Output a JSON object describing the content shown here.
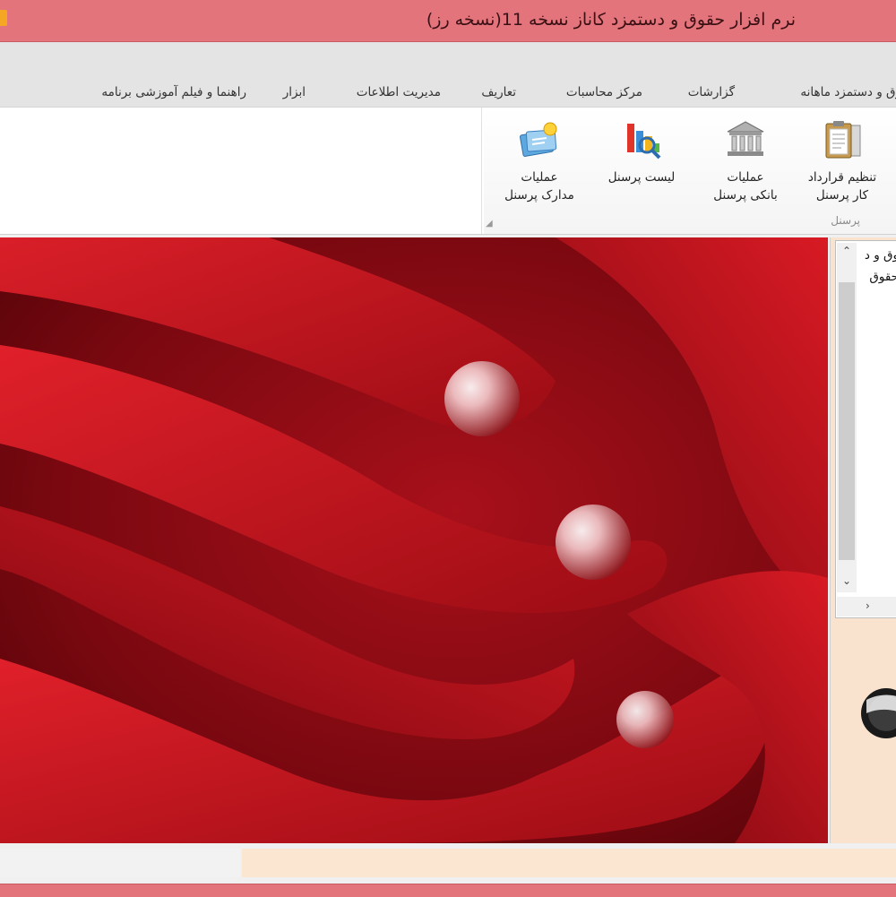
{
  "window": {
    "title": "نرم افزار حقوق و دستمزد کاناز نسخه 11(نسخه رز)"
  },
  "tabs": [
    {
      "label": "وق و دستمزد ماهانه"
    },
    {
      "label": "گزارشات"
    },
    {
      "label": "مرکز محاسبات"
    },
    {
      "label": "تعاریف"
    },
    {
      "label": "مدیریت اطلاعات"
    },
    {
      "label": "ابزار"
    },
    {
      "label": "راهنما و فیلم آموزشی برنامه"
    }
  ],
  "ribbon": {
    "group_label": "پرسنل",
    "buttons": [
      {
        "label": "تنظیم قرارداد\nکار پرسنل",
        "icon": "clipboard-icon"
      },
      {
        "label": "عملیات\nبانکی پرسنل",
        "icon": "bank-icon"
      },
      {
        "label": "لیست پرسنل",
        "icon": "chart-icon"
      },
      {
        "label": "عملیات\nمدارک پرسنل",
        "icon": "documents-icon"
      }
    ]
  },
  "tree": {
    "items": [
      {
        "label": "وق و د"
      },
      {
        "label": "حقوق"
      }
    ]
  },
  "colors": {
    "titlebar": "#e3747b",
    "status_panel": "#fbe6d2"
  }
}
